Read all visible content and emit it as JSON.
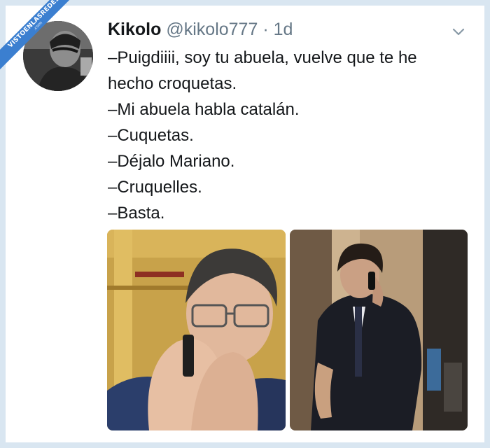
{
  "watermark": {
    "line1": "VISTOENLASREDES",
    "line2": ".com"
  },
  "tweet": {
    "author_name": "Kikolo",
    "author_handle": "@kikolo777",
    "separator": "·",
    "time": "1d",
    "lines": [
      "–Puigdiiii, soy tu abuela, vuelve que te he",
      "hecho croquetas.",
      "–Mi abuela habla catalán.",
      "–Cuquetas.",
      "–Déjalo Mariano.",
      "–Cruquelles.",
      "–Basta."
    ]
  },
  "icons": {
    "avatar": "avatar-photo",
    "menu": "chevron-down-icon"
  },
  "colors": {
    "background": "#d9e6f1",
    "card": "#ffffff",
    "text": "#14171a",
    "muted": "#657786",
    "ribbon": "#3b7fd0"
  }
}
